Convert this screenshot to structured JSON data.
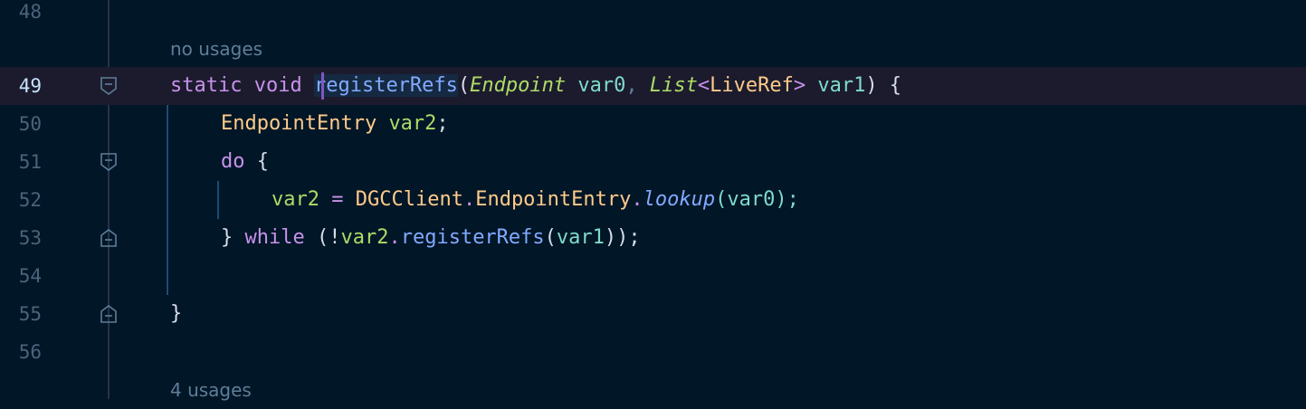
{
  "editor": {
    "hints": {
      "top": "no usages",
      "bottom": "4 usages"
    },
    "lines": [
      {
        "num": "48"
      },
      {
        "num": "49"
      },
      {
        "num": "50"
      },
      {
        "num": "51"
      },
      {
        "num": "52"
      },
      {
        "num": "53"
      },
      {
        "num": "54"
      },
      {
        "num": "55"
      },
      {
        "num": "56"
      }
    ],
    "tokens": {
      "static": "static",
      "void": "void",
      "method_name": "registerRefs",
      "paren_open": "(",
      "endpoint_type": "Endpoint",
      "var0": "var0",
      "comma": ",",
      "list_type": "List",
      "lt": "<",
      "liveref_type": "LiveRef",
      "gt": ">",
      "var1": "var1",
      "sig_close": ") {",
      "entry_type": "EndpointEntry",
      "var2": "var2",
      "semi": ";",
      "do": "do",
      "brace_open": "{",
      "assign": "=",
      "dgc_client": "DGCClient",
      "dot": ".",
      "entry_cls": "EndpointEntry",
      "lookup": "lookup",
      "lookup_arg": "(var0);",
      "close_brace": "}",
      "while": "while",
      "cond_open": "(!",
      "register_call": "registerRefs",
      "call_open": "(",
      "call_close": "));",
      "method_close": "}"
    }
  }
}
